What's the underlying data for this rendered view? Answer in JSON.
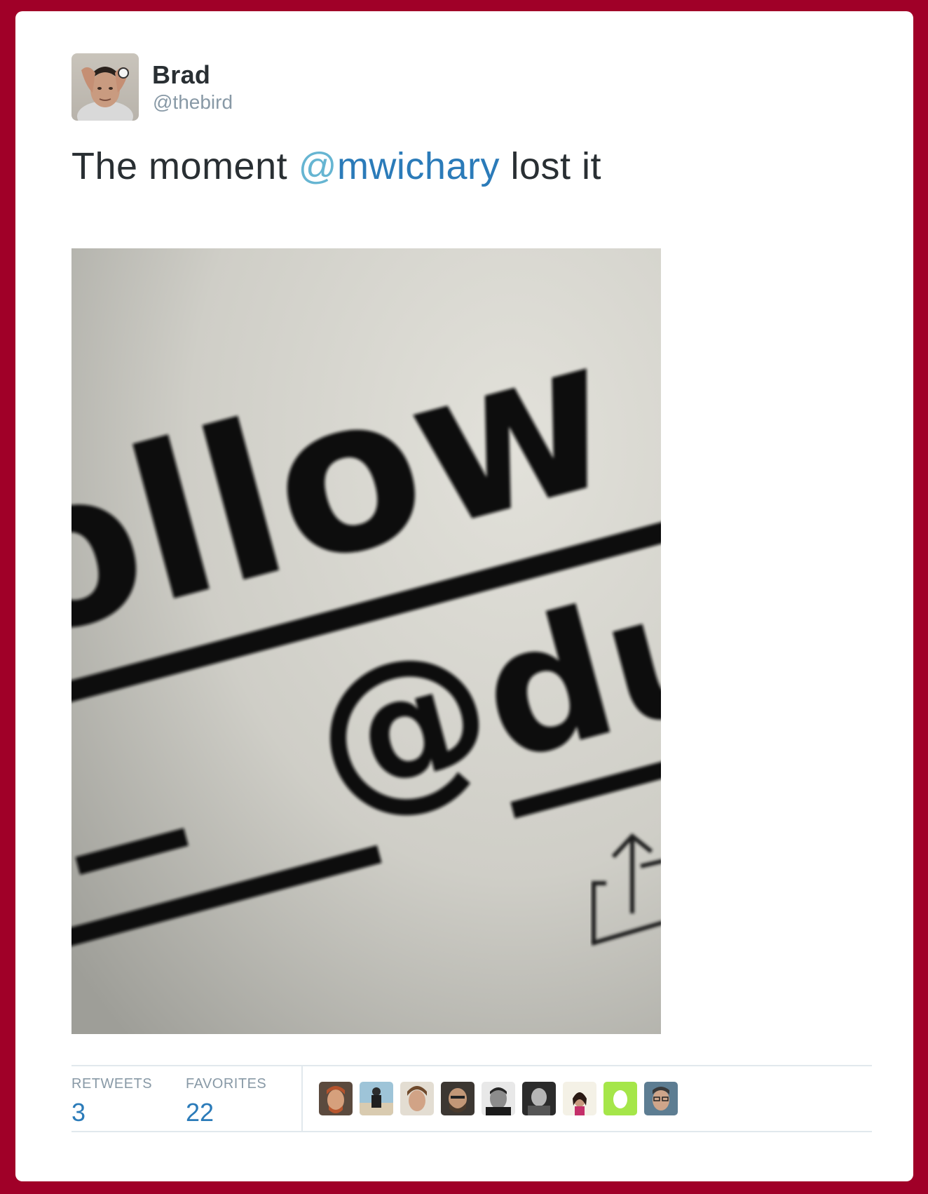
{
  "tweet": {
    "author": {
      "name": "Brad",
      "handle": "@thebird"
    },
    "text": {
      "before": "The moment ",
      "mention_at": "@",
      "mention_name": "mwichary",
      "after": " lost it"
    },
    "photo": {
      "line1": "ollow",
      "line2": "@dus",
      "share_icon": "share-icon"
    },
    "stats": {
      "retweets_label": "RETWEETS",
      "retweets_value": "3",
      "favorites_label": "FAVORITES",
      "favorites_value": "22"
    },
    "favoriters": [
      {
        "avatar": "avatar-redhead"
      },
      {
        "avatar": "avatar-beach"
      },
      {
        "avatar": "avatar-curly"
      },
      {
        "avatar": "avatar-bearded"
      },
      {
        "avatar": "avatar-bw-1"
      },
      {
        "avatar": "avatar-bw-2"
      },
      {
        "avatar": "avatar-woman"
      },
      {
        "avatar": "avatar-egg"
      },
      {
        "avatar": "avatar-glasses"
      }
    ]
  },
  "colors": {
    "background": "#a00028",
    "link": "#2b7bb9",
    "muted": "#8899a6",
    "text": "#292f33",
    "egg_avatar": "#a5e649"
  }
}
